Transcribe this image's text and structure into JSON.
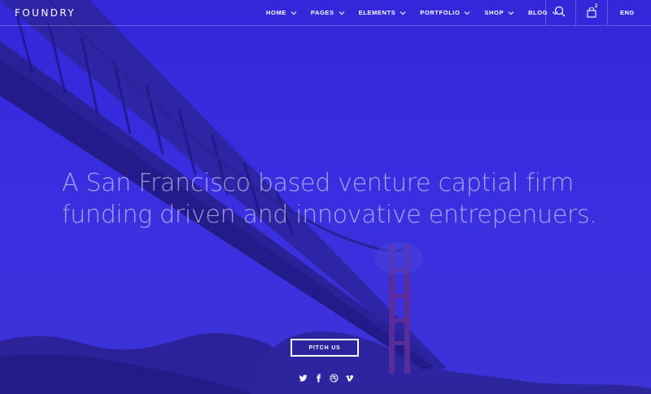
{
  "brand": {
    "name": "FOUNDRY"
  },
  "nav": {
    "items": [
      {
        "label": "HOME"
      },
      {
        "label": "PAGES"
      },
      {
        "label": "ELEMENTS"
      },
      {
        "label": "PORTFOLIO"
      },
      {
        "label": "SHOP"
      },
      {
        "label": "BLOG"
      }
    ],
    "cart_count": "2",
    "language": "ENG"
  },
  "hero": {
    "headline_line1": "A San Francisco based venture captial firm",
    "headline_line2": "funding driven and innovative entrepenuers.",
    "cta_label": "PITCH US"
  },
  "social": [
    "twitter-icon",
    "facebook-icon",
    "dribbble-icon",
    "vimeo-icon"
  ],
  "colors": {
    "overlay": "#3a2fd8",
    "text": "#ffffff"
  }
}
